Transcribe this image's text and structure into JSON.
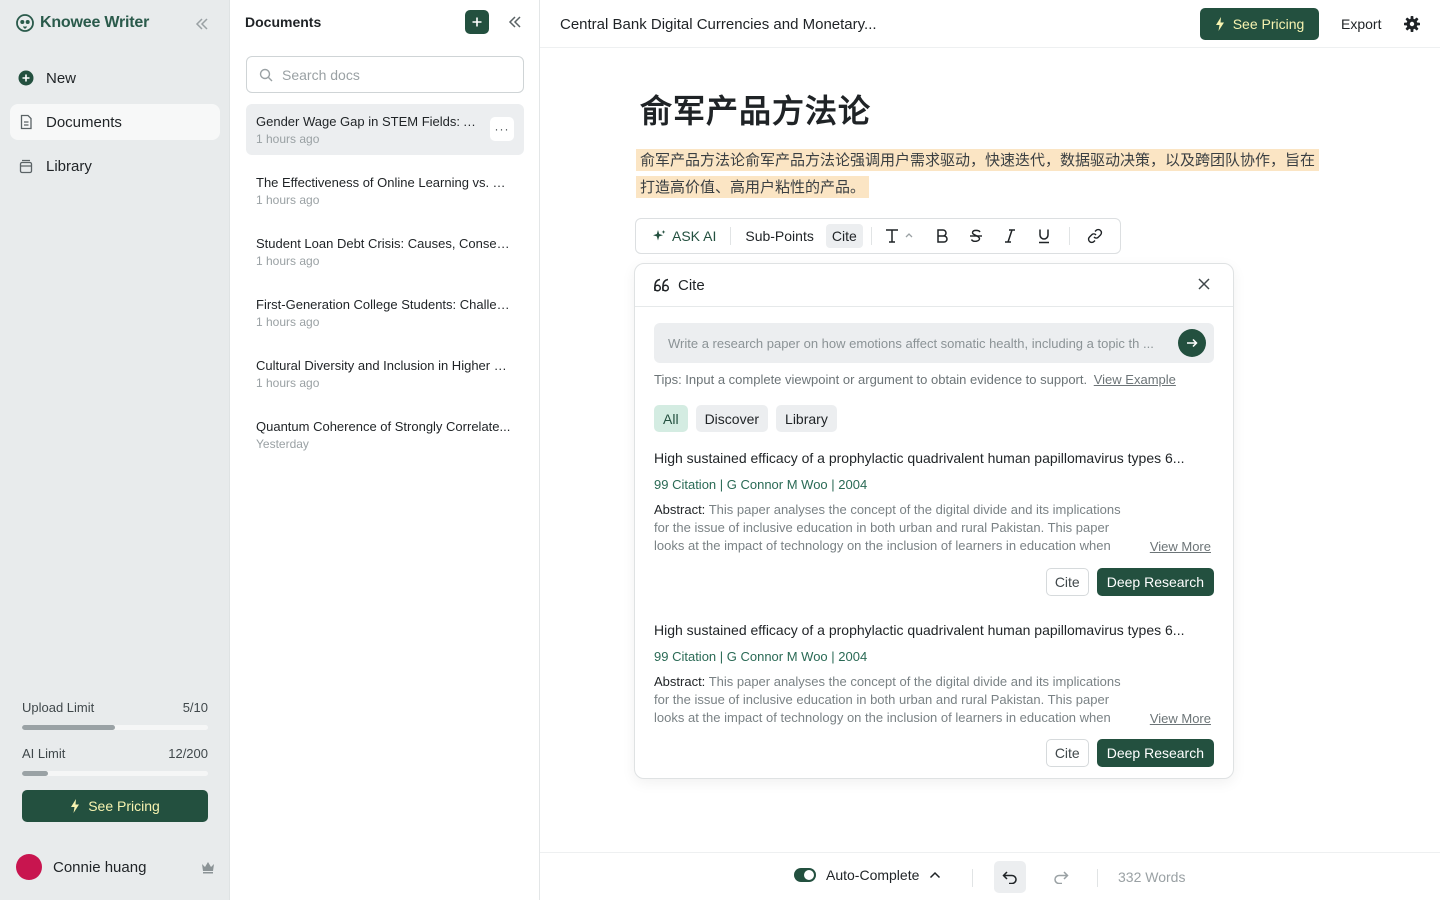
{
  "app": {
    "name": "Knowee Writer"
  },
  "sidebar": {
    "items": [
      {
        "label": "New",
        "icon": "plus-circle-icon"
      },
      {
        "label": "Documents",
        "icon": "document-icon",
        "active": true
      },
      {
        "label": "Library",
        "icon": "library-icon"
      }
    ],
    "limits": [
      {
        "label": "Upload Limit",
        "value": "5/10",
        "used": 5,
        "total": 10
      },
      {
        "label": "AI Limit",
        "value": "12/200",
        "used": 12,
        "total": 200
      }
    ],
    "pricing_label": "See Pricing",
    "user": {
      "name": "Connie huang",
      "avatar_color": "#c8154f"
    }
  },
  "docs": {
    "title": "Documents",
    "search_placeholder": "Search docs",
    "items": [
      {
        "title": "Gender Wage Gap in STEM Fields: A...",
        "time": "1 hours ago",
        "active": true
      },
      {
        "title": "The Effectiveness of Online Learning vs. Tr...",
        "time": "1 hours ago"
      },
      {
        "title": "Student Loan Debt Crisis: Causes, Conseq...",
        "time": "1 hours ago"
      },
      {
        "title": "First-Generation College Students: Challen...",
        "time": "1 hours ago"
      },
      {
        "title": "Cultural Diversity and Inclusion in Higher E...",
        "time": "1 hours ago"
      },
      {
        "title": "Quantum Coherence of Strongly Correlate...",
        "time": "Yesterday"
      }
    ],
    "more_label": "···"
  },
  "editor": {
    "doc_heading": "Central Bank Digital Currencies and Monetary...",
    "pricing_label": "See Pricing",
    "export_label": "Export",
    "page_title": "俞军产品方法论",
    "highlighted_text": "俞军产品方法论俞军产品方法论强调用户需求驱动，快速迭代，数据驱动决策，以及跨团队协作，旨在打造高价值、高用户粘性的产品。",
    "toolbar": {
      "ask_ai": "ASK AI",
      "sub_points": "Sub-Points",
      "cite": "Cite"
    },
    "cite_panel": {
      "title": "Cite",
      "query": "Write a research paper on how emotions affect somatic health, including a topic th ...",
      "tips": "Tips: Input a complete viewpoint or argument to obtain evidence to support.",
      "view_example": "View Example",
      "filters": [
        "All",
        "Discover",
        "Library"
      ],
      "results": [
        {
          "title": "High sustained efficacy of a prophylactic quadrivalent human papillomavirus types 6...",
          "meta": "99 Citation | G Connor M Woo | 2004",
          "abstract_label": "Abstract:",
          "abstract": "This paper analyses the concept of the digital divide and its implications for the issue of inclusive education in both urban and rural Pakistan. This paper looks at the impact of technology on the inclusion of learners in education when technology is distrib...",
          "view_more": "View More",
          "cite_label": "Cite",
          "deep_label": "Deep Research"
        },
        {
          "title": "High sustained efficacy of a prophylactic quadrivalent human papillomavirus types 6...",
          "meta": "99 Citation | G Connor M Woo | 2004",
          "abstract_label": "Abstract:",
          "abstract": "This paper analyses the concept of the digital divide and its implications for the issue of inclusive education in both urban and rural Pakistan. This paper looks at the impact of technology on the inclusion of learners in education when technology is distrib...",
          "view_more": "View More",
          "cite_label": "Cite",
          "deep_label": "Deep Research"
        }
      ]
    },
    "statusbar": {
      "autocomplete_label": "Auto-Complete",
      "autocomplete_on": true,
      "word_count": "332 Words"
    }
  },
  "colors": {
    "accent": "#23503f",
    "highlight": "#fbe5c4",
    "pricing_text": "#f7f3b0"
  }
}
